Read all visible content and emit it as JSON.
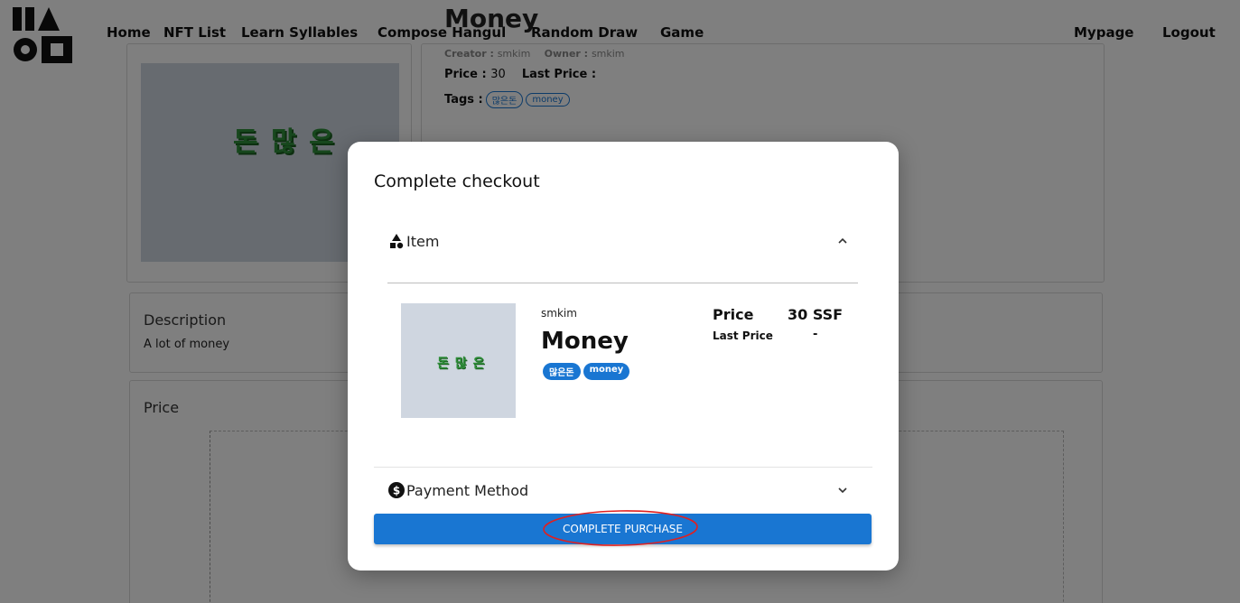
{
  "nav": {
    "links": [
      "Home",
      "NFT List",
      "Learn Syllables",
      "Compose Hangul",
      "Random Draw",
      "Game"
    ],
    "right_links": [
      "Mypage",
      "Logout"
    ]
  },
  "nft": {
    "title": "Money",
    "creator_label": "Creator :",
    "creator": "smkim",
    "owner_label": "Owner :",
    "owner": "smkim",
    "price_label": "Price :",
    "price": "30",
    "last_price_label": "Last Price :",
    "tags_label": "Tags :",
    "tags": [
      "많은돈",
      "money"
    ],
    "image_glyph": "돈 많 은"
  },
  "description": {
    "label": "Description",
    "text": "A lot of money"
  },
  "price_section": {
    "label": "Price"
  },
  "checkout": {
    "title": "Complete checkout",
    "item_section": "Item",
    "creator": "smkim",
    "item_name": "Money",
    "tags": [
      "많은돈",
      "money"
    ],
    "price_label": "Price",
    "price_value": "30 SSF",
    "last_price_label": "Last Price",
    "last_price_value": "-",
    "payment_section": "Payment Method",
    "purchase_button": "COMPLETE PURCHASE",
    "thumb_glyph": "돈 많 은"
  },
  "colors": {
    "primary": "#1976d2",
    "overlay": "rgba(0,0,0,0.5)",
    "annotation": "#e02020"
  }
}
